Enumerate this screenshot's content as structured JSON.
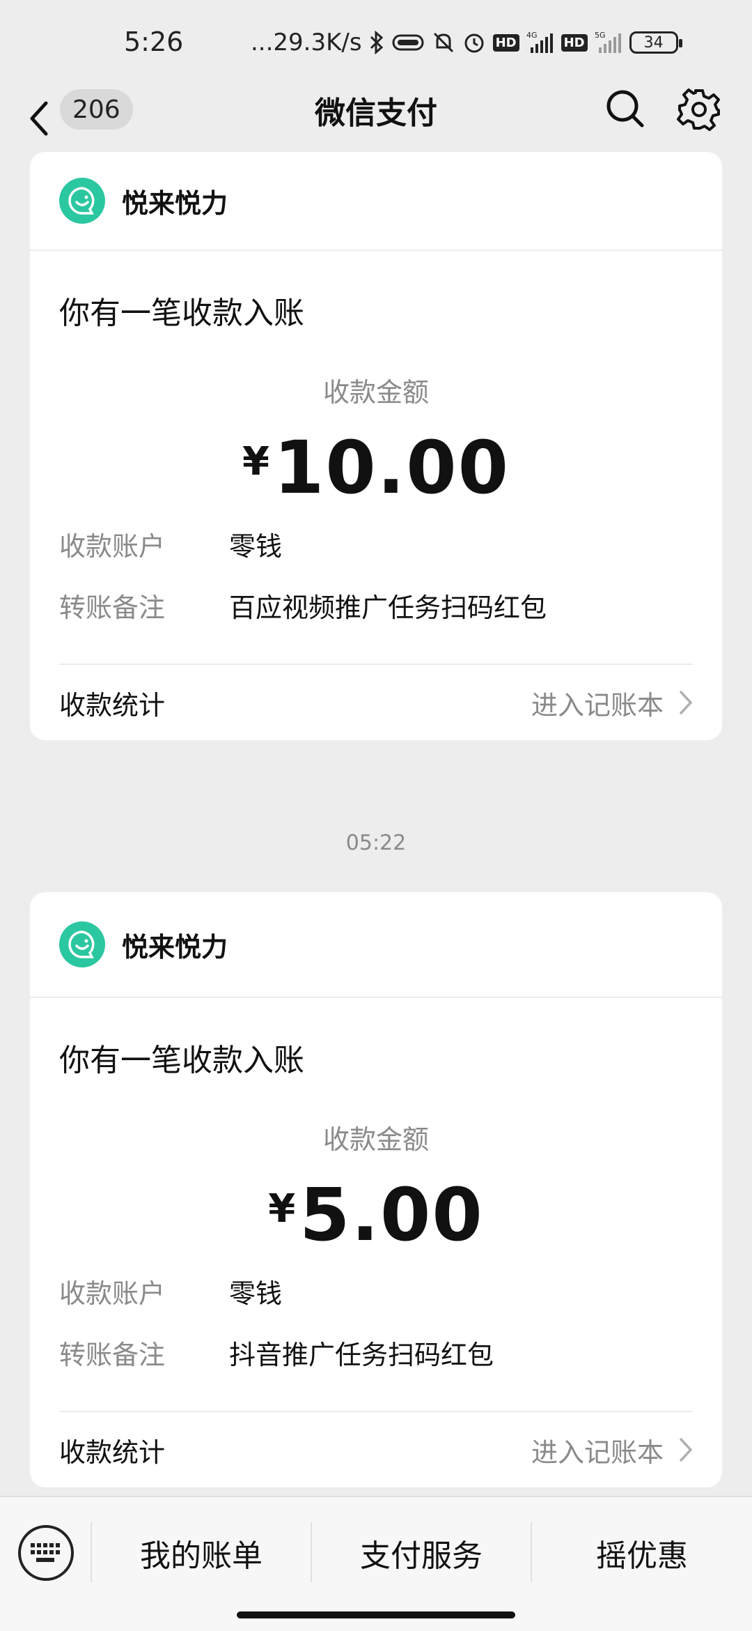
{
  "status_bar": {
    "time": "5:26",
    "net_speed": "...29.3K/s",
    "hd1": "HD",
    "net1": "4G",
    "hd2": "HD",
    "net2": "5G",
    "battery": "34"
  },
  "nav": {
    "unread_count": "206",
    "title": "微信支付",
    "icons": [
      "back-arrow-icon",
      "search-icon",
      "gear-icon"
    ]
  },
  "cards": [
    {
      "merchant": "悦来悦力",
      "notice": "你有一笔收款入账",
      "amount_label": "收款金额",
      "currency": "¥",
      "amount": "10.00",
      "account_label": "收款账户",
      "account_value": "零钱",
      "remark_label": "转账备注",
      "remark_value": "百应视频推广任务扫码红包",
      "stats_label": "收款统计",
      "stats_link": "进入记账本"
    },
    {
      "merchant": "悦来悦力",
      "notice": "你有一笔收款入账",
      "amount_label": "收款金额",
      "currency": "¥",
      "amount": "5.00",
      "account_label": "收款账户",
      "account_value": "零钱",
      "remark_label": "转账备注",
      "remark_value": "抖音推广任务扫码红包",
      "stats_label": "收款统计",
      "stats_link": "进入记账本"
    }
  ],
  "timestamp": "05:22",
  "bottom_menu": [
    "我的账单",
    "支付服务",
    "摇优惠"
  ],
  "colors": {
    "background": "#ededed",
    "merchant_logo": "#2bc7a0",
    "muted_text": "#8a8a8a"
  }
}
